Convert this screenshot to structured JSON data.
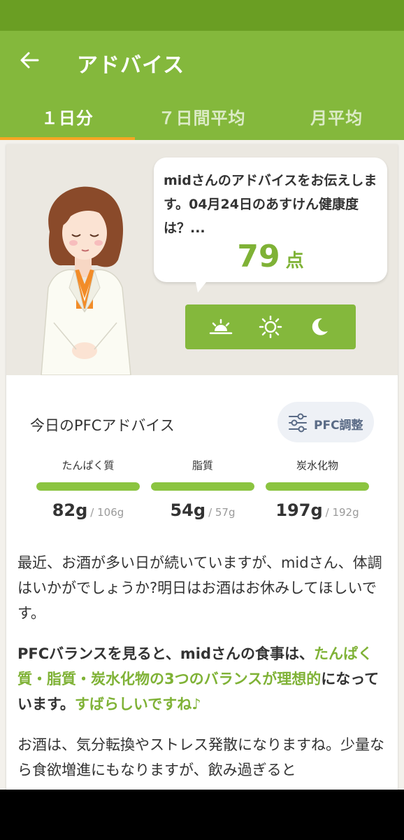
{
  "app_bar": {
    "title": "アドバイス",
    "back_icon": "arrow-left-icon"
  },
  "tabs": [
    {
      "label": "１日分",
      "active": true
    },
    {
      "label": "７日間平均",
      "active": false
    },
    {
      "label": "月平均",
      "active": false
    }
  ],
  "advice_bubble": {
    "message": "midさんのアドバイスをお伝えします。04月24日のあすけん健康度は？...",
    "score": "79",
    "score_unit": "点"
  },
  "time_toggle": {
    "icons": [
      "sunrise-icon",
      "sun-icon",
      "moon-icon"
    ]
  },
  "pfc": {
    "title": "今日のPFCアドバイス",
    "adjust_label": "PFC調整",
    "adjust_icon": "sliders-icon",
    "items": [
      {
        "label": "たんぱく質",
        "value": "82g",
        "target": "/ 106g",
        "progress": 1.0
      },
      {
        "label": "脂質",
        "value": "54g",
        "target": "/ 57g",
        "progress": 1.0
      },
      {
        "label": "炭水化物",
        "value": "197g",
        "target": "/ 192g",
        "progress": 1.0
      }
    ]
  },
  "paragraphs": {
    "p1": "最近、お酒が多い日が続いていますが、midさん、体調はいかがでしょうか?明日はお酒はお休みしてほしいです。",
    "p2_a": "PFCバランスを見ると、midさんの食事は、",
    "p2_b": "たんぱく質・脂質・炭水化物の3つのバランスが理想的",
    "p2_c": "になっています。",
    "p2_d": "すばらしいですね♪",
    "p3": "お酒は、気分転換やストレス発散になりますね。少量なら食欲増進にもなりますが、飲み過ぎると"
  },
  "colors": {
    "status_bar": "#6a9e23",
    "primary": "#84b83c",
    "tab_indicator": "#f5a623",
    "accent_text": "#7fb236",
    "progress": "#8bc440"
  }
}
